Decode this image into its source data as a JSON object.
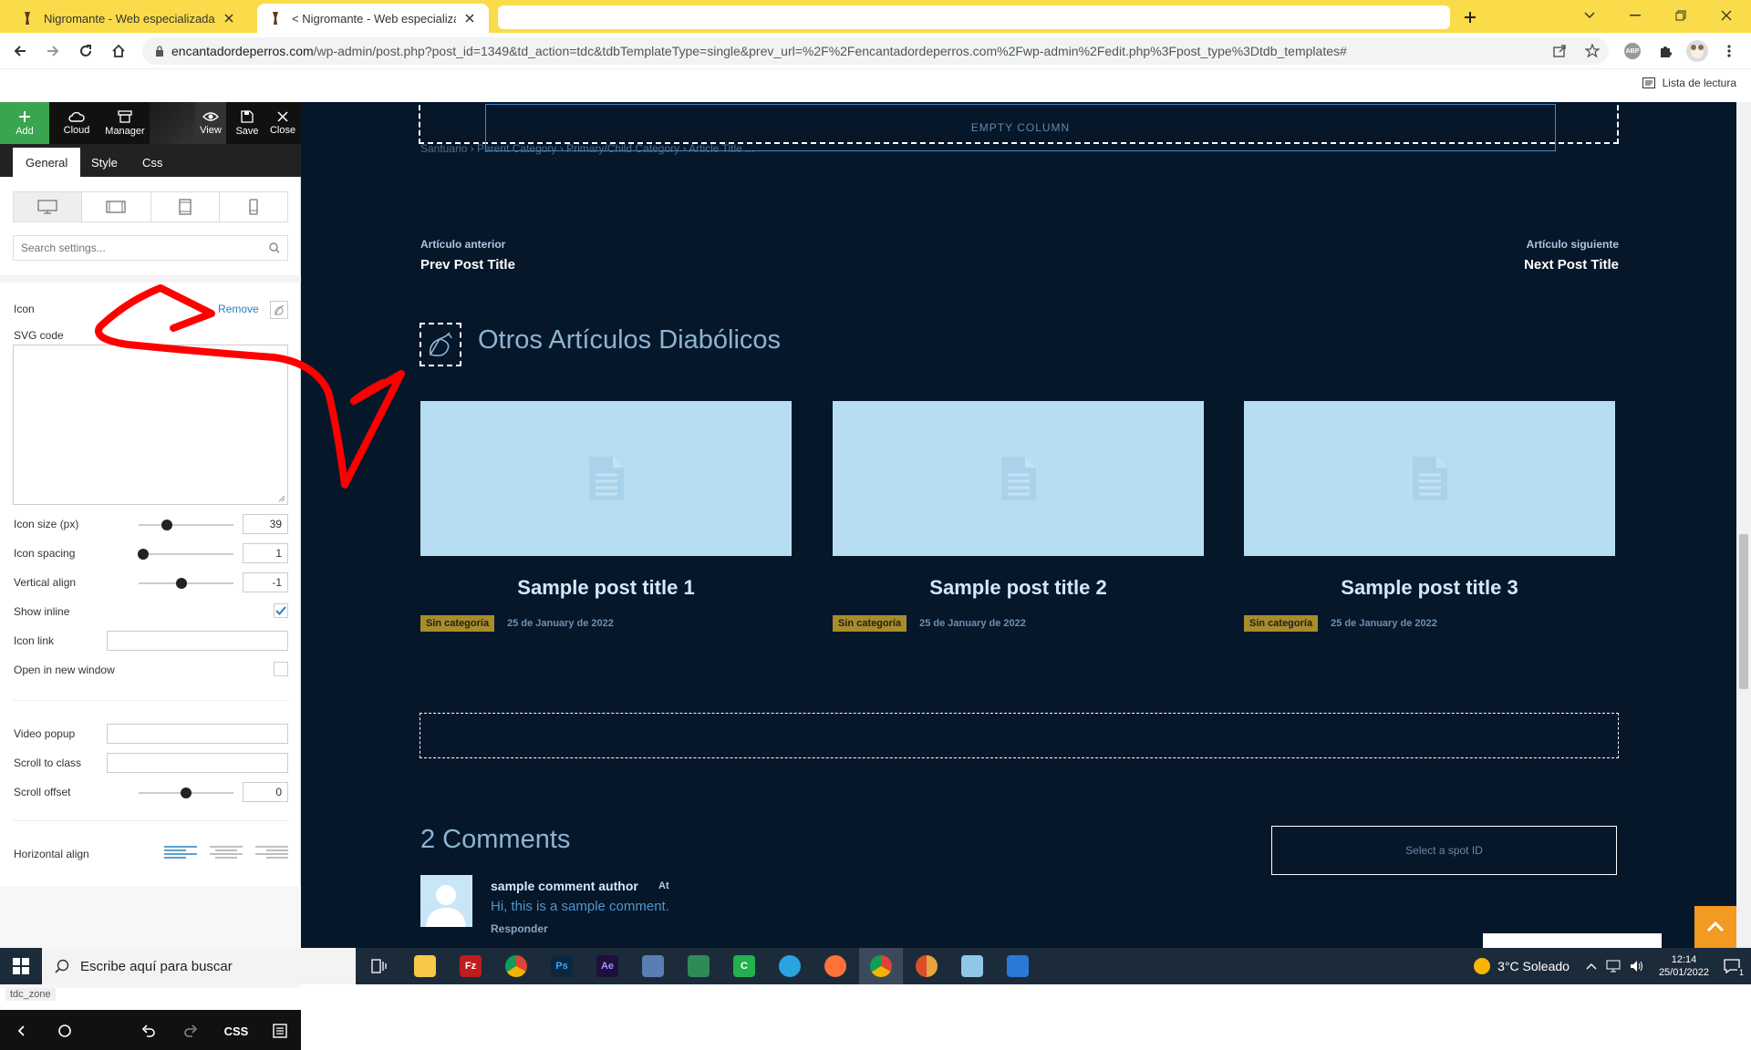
{
  "browser": {
    "tabs": [
      {
        "title": "Nigromante - Web especializada"
      },
      {
        "title": "< Nigromante - Web especializada"
      }
    ],
    "url_domain": "encantadordeperros.com",
    "url_path": "/wp-admin/post.php?post_id=1349&td_action=tdc&tdbTemplateType=single&prev_url=%2F%2Fencantadordeperros.com%2Fwp-admin%2Fedit.php%3Fpost_type%3Dtdb_templates#",
    "reading_list": "Lista de lectura",
    "extension_badge": "ABP"
  },
  "editor": {
    "toolbar": {
      "add": "Add",
      "cloud": "Cloud",
      "manager": "Manager",
      "view": "View",
      "save": "Save",
      "close": "Close"
    },
    "tabs": {
      "general": "General",
      "style": "Style",
      "css": "Css"
    },
    "search_placeholder": "Search settings...",
    "icon_label": "Icon",
    "remove_link": "Remove",
    "svg_code_label": "SVG code",
    "settings": {
      "icon_size": {
        "label": "Icon size (px)",
        "value": "39",
        "level": 0.3
      },
      "icon_spacing": {
        "label": "Icon spacing",
        "value": "1",
        "level": 0.05
      },
      "vertical_align": {
        "label": "Vertical align",
        "value": "-1",
        "level": 0.45
      },
      "show_inline": {
        "label": "Show inline",
        "checked": true
      },
      "icon_link": {
        "label": "Icon link",
        "value": ""
      },
      "open_new_window": {
        "label": "Open in new window",
        "checked": false
      },
      "video_popup": {
        "label": "Video popup",
        "value": ""
      },
      "scroll_to_class": {
        "label": "Scroll to class",
        "value": ""
      },
      "scroll_offset": {
        "label": "Scroll offset",
        "value": "0",
        "level": 0.5
      },
      "horizontal_align": {
        "label": "Horizontal align",
        "selected": "left"
      }
    },
    "zone_tag": "tdc_zone",
    "bottom_css": "CSS"
  },
  "canvas": {
    "empty_column": "EMPTY COLUMN",
    "breadcrumb": "Santuario › Parent Category › Primary/Child Category › Article Title ...",
    "prev_label": "Artículo anterior",
    "prev_title": "Prev Post Title",
    "next_label": "Artículo siguiente",
    "next_title": "Next Post Title",
    "section_heading": "Otros Artículos Diabólicos",
    "posts": [
      {
        "title": "Sample post title 1",
        "category": "Sin categoría",
        "date": "25 de January de 2022"
      },
      {
        "title": "Sample post title 2",
        "category": "Sin categoría",
        "date": "25 de January de 2022"
      },
      {
        "title": "Sample post title 3",
        "category": "Sin categoría",
        "date": "25 de January de 2022"
      }
    ],
    "comments_heading": "2 Comments",
    "spot_id": "Select a spot ID",
    "comment": {
      "author": "sample comment author",
      "at": "At",
      "text": "Hi, this is a sample comment.",
      "reply": "Responder"
    },
    "colors": {
      "background": "#06172a",
      "accent": "#f29a21",
      "category": "#a98c2a",
      "annotation_arrow": "#ff0000"
    }
  },
  "taskbar": {
    "search_placeholder": "Escribe aquí para buscar",
    "weather": "3°C  Soleado",
    "time": "12:14",
    "date": "25/01/2022",
    "notification_count": "1"
  }
}
